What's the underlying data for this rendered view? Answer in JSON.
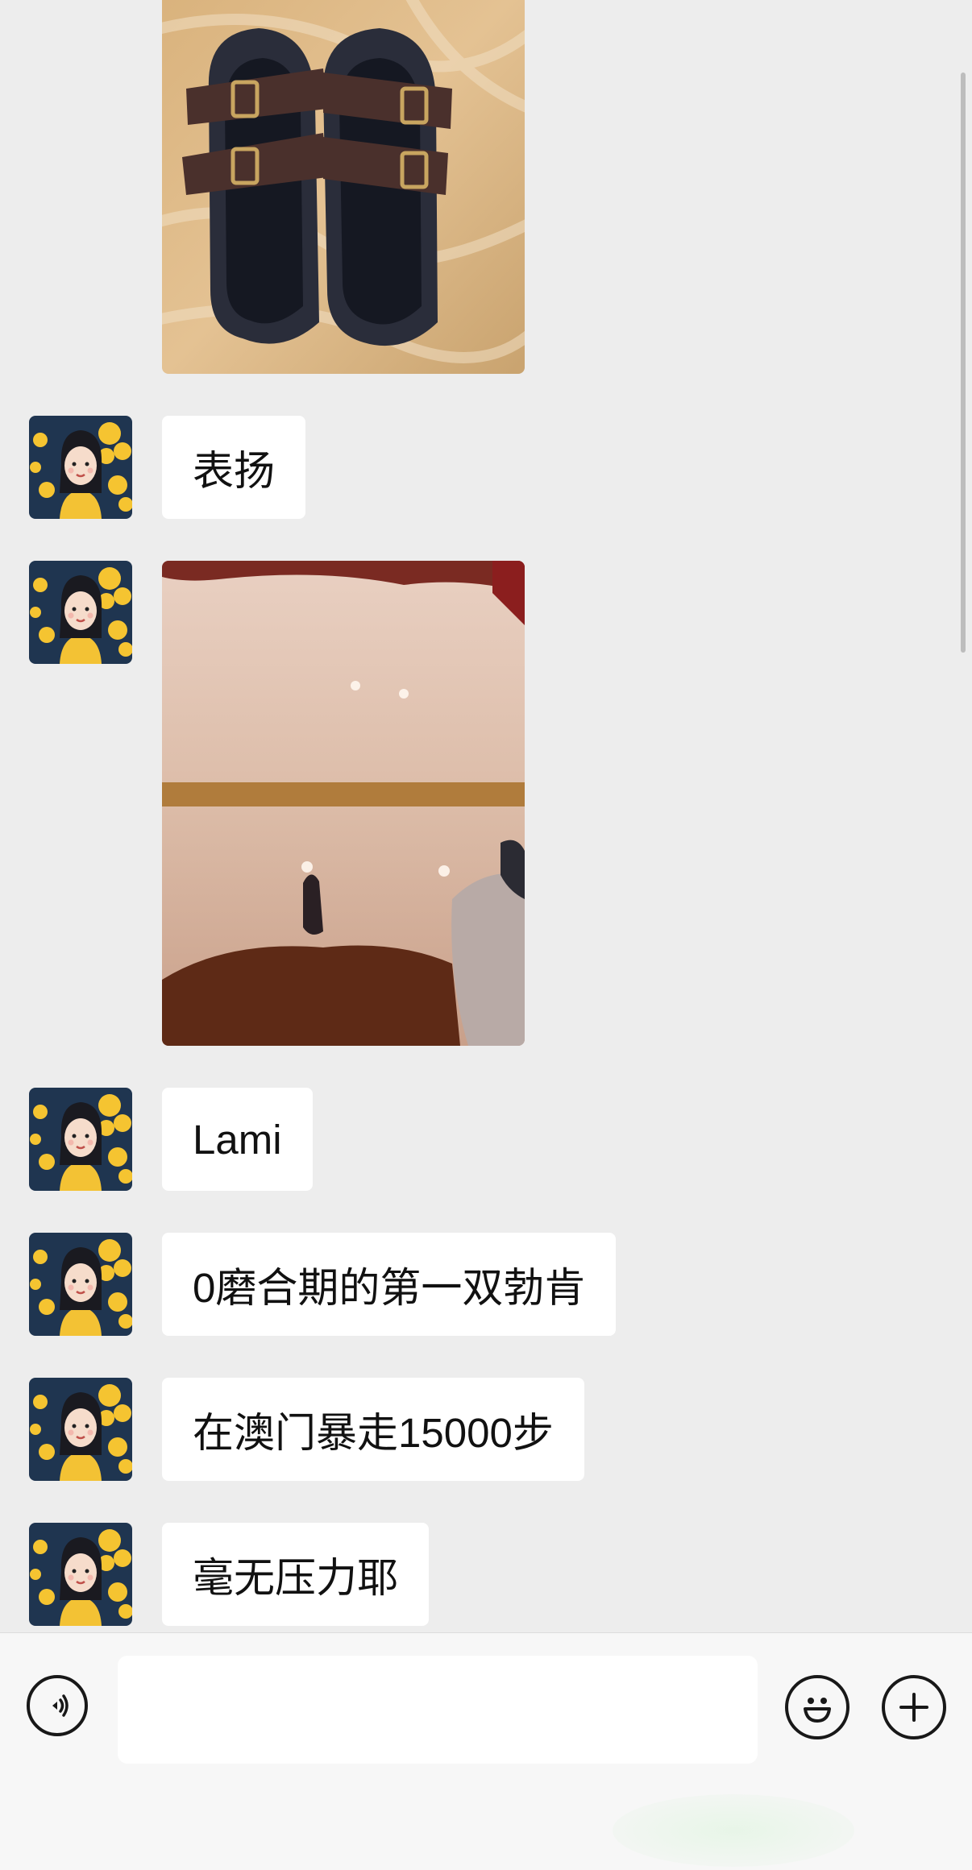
{
  "messages": [
    {
      "type": "image",
      "subject": "sandals-on-rug"
    },
    {
      "type": "text",
      "text": "表扬"
    },
    {
      "type": "image",
      "subject": "floor-with-feet"
    },
    {
      "type": "text",
      "text": "Lami"
    },
    {
      "type": "text",
      "text": "0磨合期的第一双勃肯"
    },
    {
      "type": "text",
      "text": "在澳门暴走15000步"
    },
    {
      "type": "text",
      "text": "毫无压力耶"
    }
  ],
  "input": {
    "value": "",
    "placeholder": ""
  },
  "icons": {
    "voice": "voice-icon",
    "emoji": "emoji-icon",
    "add": "plus-icon"
  },
  "colors": {
    "background": "#ededed",
    "bubble": "#ffffff",
    "input_bar": "#f7f7f7",
    "text": "#111111"
  }
}
